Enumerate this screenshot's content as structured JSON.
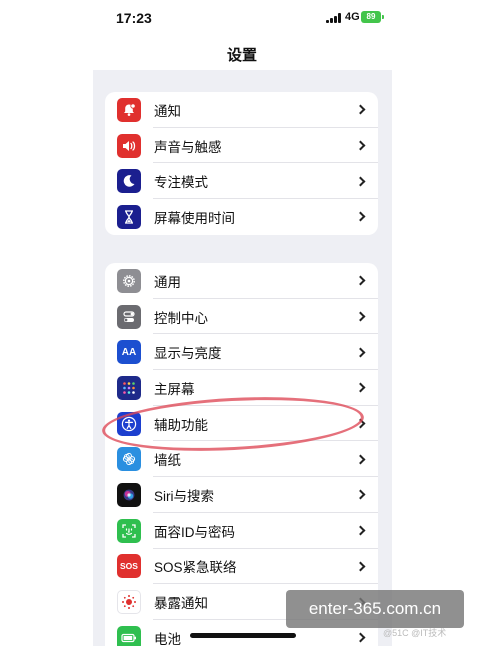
{
  "status_bar": {
    "time": "17:23",
    "network": "4G",
    "battery": "89"
  },
  "nav": {
    "title": "设置"
  },
  "groups": [
    {
      "items": [
        {
          "label": "通知",
          "icon": "bell-icon",
          "color": "#e0302e"
        },
        {
          "label": "声音与触感",
          "icon": "speaker-icon",
          "color": "#e0302e"
        },
        {
          "label": "专注模式",
          "icon": "moon-icon",
          "color": "#5b3fd1"
        },
        {
          "label": "屏幕使用时间",
          "icon": "hourglass-icon",
          "color": "#5b3fd1"
        }
      ]
    },
    {
      "items": [
        {
          "label": "通用",
          "icon": "gear-icon",
          "color": "#8e8e93"
        },
        {
          "label": "控制中心",
          "icon": "toggles-icon",
          "color": "#8e8e93"
        },
        {
          "label": "显示与亮度",
          "icon": "aa-icon",
          "color": "#1c6fe0"
        },
        {
          "label": "主屏幕",
          "icon": "app-grid-icon",
          "color": "#2b3fd8"
        },
        {
          "label": "辅助功能",
          "icon": "accessibility-icon",
          "color": "#1c6fe0"
        },
        {
          "label": "墙纸",
          "icon": "flower-icon",
          "color": "#2a9ff0"
        },
        {
          "label": "Siri与搜索",
          "icon": "siri-icon",
          "color": "#222222"
        },
        {
          "label": "面容ID与密码",
          "icon": "face-id-icon",
          "color": "#2fbf4f"
        },
        {
          "label": "SOS紧急联络",
          "icon": "sos-icon",
          "color": "#e0302e"
        },
        {
          "label": "暴露通知",
          "icon": "exposure-icon",
          "color": "#ffffff"
        },
        {
          "label": "电池",
          "icon": "battery-icon",
          "color": "#2fbf4f"
        }
      ]
    }
  ],
  "icon_text": {
    "aa": "AA",
    "sos": "SOS"
  },
  "annotation_color": "#de4856",
  "watermark": {
    "text": "enter-365.com.cn",
    "small": "@51C @IT技术"
  }
}
